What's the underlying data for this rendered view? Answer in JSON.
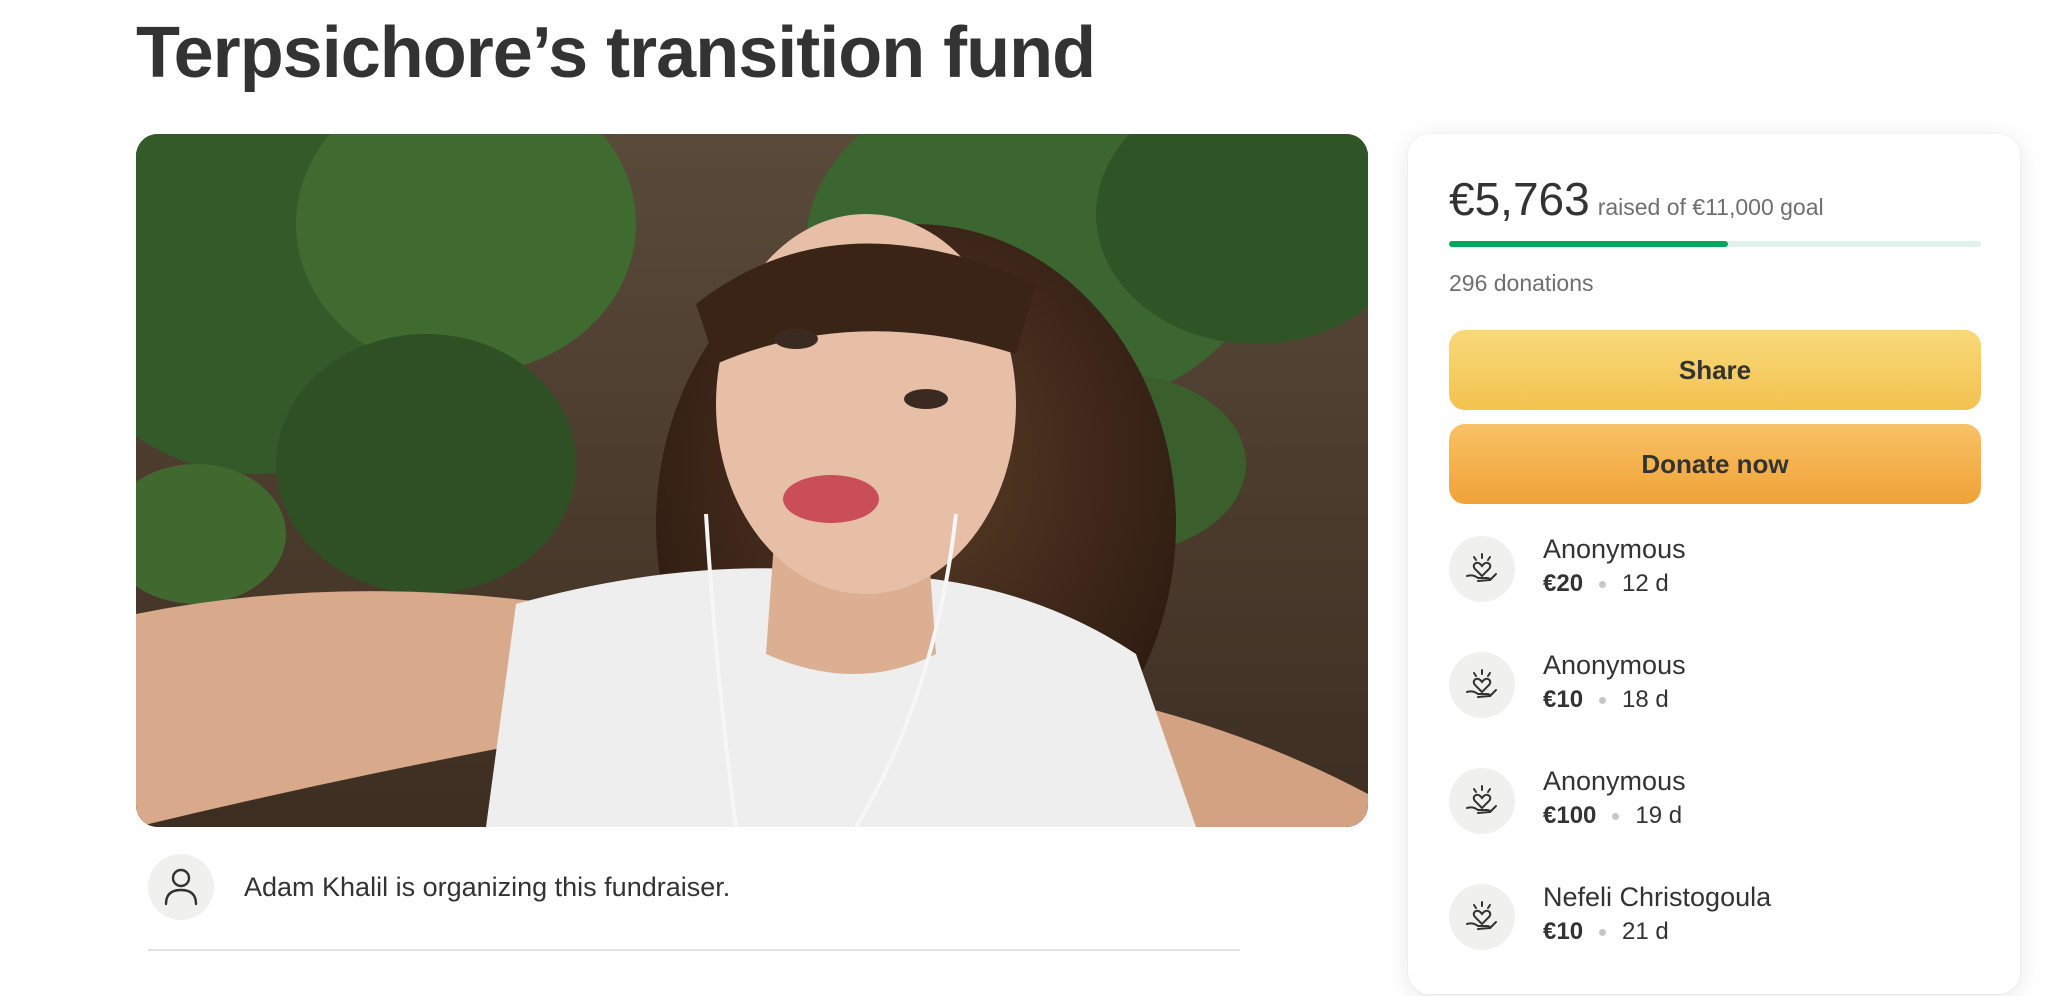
{
  "page": {
    "title": "Terpsichore’s transition fund"
  },
  "organizer": {
    "text": "Adam Khalil is organizing this fundraiser.",
    "icon": "person-icon"
  },
  "summary": {
    "raised": "€5,763",
    "goal_text": "raised of €11,000 goal",
    "progress_fraction": 0.524,
    "donations_count": "296 donations"
  },
  "buttons": {
    "share_label": "Share",
    "donate_label": "Donate now"
  },
  "donations": [
    {
      "name": "Anonymous",
      "amount": "€20",
      "age": "12 d",
      "icon": "hand-heart-icon"
    },
    {
      "name": "Anonymous",
      "amount": "€10",
      "age": "18 d",
      "icon": "hand-heart-icon"
    },
    {
      "name": "Anonymous",
      "amount": "€100",
      "age": "19 d",
      "icon": "hand-heart-icon"
    },
    {
      "name": "Nefeli Christogoula",
      "amount": "€10",
      "age": "21 d",
      "icon": "hand-heart-icon"
    }
  ],
  "colors": {
    "progress": "#02a95c",
    "progress_track": "#e1f2ec",
    "share_button": "#f3c24f",
    "donate_button": "#f0a237",
    "text": "#333333"
  }
}
